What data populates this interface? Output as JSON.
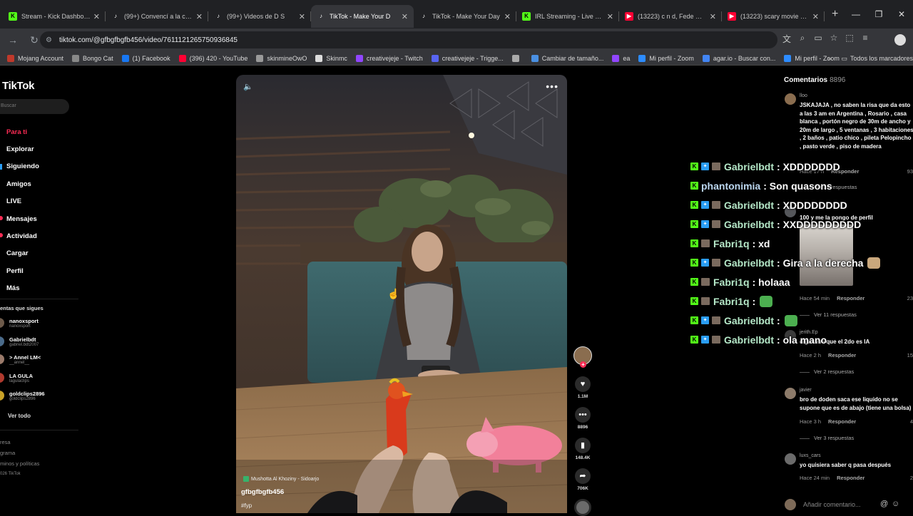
{
  "browser": {
    "tabs": [
      {
        "title": "Stream - Kick Dashboard",
        "icon": "kick-icon",
        "color": "#53fc18",
        "active": false
      },
      {
        "title": "(99+) Convencí a la chica a",
        "icon": "tiktok-icon",
        "color": "#ffffff",
        "active": false
      },
      {
        "title": "(99+) Videos de D  S",
        "icon": "tiktok-icon",
        "color": "#ffffff",
        "active": false
      },
      {
        "title": "TikTok - Make Your D",
        "icon": "tiktok-icon",
        "color": "#ffffff",
        "active": true
      },
      {
        "title": "TikTok - Make Your Day",
        "icon": "tiktok-icon",
        "color": "#ffffff",
        "active": false
      },
      {
        "title": "IRL Streaming - Live Strea",
        "icon": "kick-icon",
        "color": "#53fc18",
        "active": false
      },
      {
        "title": "(13223) c n d, Fede Guelm",
        "icon": "youtube-icon",
        "color": "#ff0033",
        "active": false
      },
      {
        "title": "(13223) scary movie 7 tra",
        "icon": "youtube-icon",
        "color": "#ff0033",
        "active": false
      }
    ],
    "new_tab": "+",
    "url": "tiktok.com/@gfbgfbgfb456/video/7611121265750936845",
    "bookmarks": [
      {
        "label": "Mojang Account",
        "color": "#c0392b"
      },
      {
        "label": "Bongo Cat",
        "color": "#888888"
      },
      {
        "label": "(1) Facebook",
        "color": "#1877f2"
      },
      {
        "label": "(396) 420 - YouTube",
        "color": "#ff0033"
      },
      {
        "label": "skinmineOwO",
        "color": "#999999"
      },
      {
        "label": "Skinmc",
        "color": "#dddddd"
      },
      {
        "label": "creativejeje - Twitch",
        "color": "#9146ff"
      },
      {
        "label": "creativejeje - Trigge...",
        "color": "#5865f2"
      },
      {
        "label": "",
        "color": "#aaaaaa"
      },
      {
        "label": "Cambiar de tamaño...",
        "color": "#4a90e2"
      },
      {
        "label": "ea",
        "color": "#9146ff"
      },
      {
        "label": "Mi perfil - Zoom",
        "color": "#2d8cff"
      },
      {
        "label": "agar.io - Buscar con...",
        "color": "#4285f4"
      },
      {
        "label": "Mi perfil - Zoom",
        "color": "#2d8cff"
      }
    ],
    "bookmarks_more": "»",
    "all_bookmarks": "Todos los marcadores"
  },
  "tiktok": {
    "logo": "TikTok",
    "search_placeholder": "Buscar",
    "nav": [
      {
        "label": "Para ti",
        "active": true
      },
      {
        "label": "Explorar",
        "active": false
      },
      {
        "label": "Siguiendo",
        "active": false
      },
      {
        "label": "Amigos",
        "active": false
      },
      {
        "label": "LIVE",
        "active": false
      },
      {
        "label": "Mensajes",
        "active": false,
        "dot": true
      },
      {
        "label": "Actividad",
        "active": false,
        "dot": true
      },
      {
        "label": "Cargar",
        "active": false
      },
      {
        "label": "Perfil",
        "active": false
      },
      {
        "label": "Más",
        "active": false
      }
    ],
    "following_header": "entas que sigues",
    "following": [
      {
        "name": "nanoxsport",
        "handle": "nanoxsport",
        "color": "#6d5a4a"
      },
      {
        "name": "Gabrielbdt",
        "handle": "gabriel.bdt2007",
        "color": "#4a6b8a"
      },
      {
        "name": "> Annel LM<",
        "handle": "__annel__",
        "color": "#9a7a6a"
      },
      {
        "name": "LA GULA",
        "handle": "lagulaclips",
        "color": "#b03a2e"
      },
      {
        "name": "goldclips2896",
        "handle": "goldclips2896",
        "color": "#c9a227"
      }
    ],
    "see_all": "Ver todo",
    "footer": [
      "resa",
      "grama",
      "minos y políticas",
      "026 TikTok"
    ]
  },
  "video": {
    "music": "Mushotta Al Khoziny - Sidoarjo",
    "author": "gfbgfbgfb456",
    "hashtag": "#fyp",
    "likes": "1.1M",
    "comments": "8896",
    "saves": "148.4K",
    "shares": "706K"
  },
  "comments": {
    "header": "Comentarios",
    "count": "8896",
    "items": [
      {
        "user": "lloo",
        "avatar": "#8a6d4f",
        "text": "JSKAJAJA , no saben la risa que da esto a las 3 am en Argentina , Rosario , casa blanca , portón negro de 30m de ancho y 20m de largo , 5 ventanas , 3 habitaciones , 2 baños , patio chico , pileta Pelopincho , pasto verde , piso de madera",
        "time": "Hace 17 h",
        "reply": "Responder",
        "likes": "93",
        "replies": "Ver 28 respuestas"
      },
      {
        "user": "",
        "avatar": "#55575b",
        "text": "100 y me la pongo de perfil",
        "time": "Hace 54 min",
        "reply": "Responder",
        "likes": "23",
        "replies": "Ver 11 respuestas"
      },
      {
        "user": "jerith.Ep",
        "avatar": "#3b3b3b",
        "text": "digamme que el 2do es IA",
        "time": "Hace 2 h",
        "reply": "Responder",
        "likes": "15",
        "replies": "Ver 2 respuestas"
      },
      {
        "user": "javier",
        "avatar": "#8d7b6a",
        "text": "bro de doden saca ese liquido no se supone que es de abajo (tiene una bolsa)",
        "time": "Hace 3 h",
        "reply": "Responder",
        "likes": "4",
        "replies": "Ver 3 respuestas"
      },
      {
        "user": "luxs_cars",
        "avatar": "#6b6b6b",
        "text": "yo quisiera saber q pasa después",
        "time": "Hace 24 min",
        "reply": "Responder",
        "likes": "2",
        "replies": ""
      }
    ],
    "add_placeholder": "Añadir comentario..."
  },
  "stream_chat": [
    {
      "user": "Gabrielbdt",
      "color": "#b5e8c8",
      "msg": ": XDDDDDDD",
      "badges": [
        "kick",
        "blue",
        "face"
      ],
      "emote": ""
    },
    {
      "user": "phantonimia",
      "color": "#bcd7f0",
      "msg": ": Son quasons",
      "badges": [
        "kick"
      ],
      "emote": ""
    },
    {
      "user": "Gabrielbdt",
      "color": "#b5e8c8",
      "msg": ": XDDDDDDDD",
      "badges": [
        "kick",
        "blue",
        "face"
      ],
      "emote": ""
    },
    {
      "user": "Gabrielbdt",
      "color": "#b5e8c8",
      "msg": ": XXDDDDDDDDD",
      "badges": [
        "kick",
        "blue",
        "face"
      ],
      "emote": ""
    },
    {
      "user": "Fabri1q",
      "color": "#b5e8c8",
      "msg": ": xd",
      "badges": [
        "kick",
        "face"
      ],
      "emote": ""
    },
    {
      "user": "Gabrielbdt",
      "color": "#b5e8c8",
      "msg": ": Gira a la derecha",
      "badges": [
        "kick",
        "blue",
        "face"
      ],
      "emote": "#c9a77c"
    },
    {
      "user": "Fabri1q",
      "color": "#b5e8c8",
      "msg": ": holaaa",
      "badges": [
        "kick",
        "face"
      ],
      "emote": ""
    },
    {
      "user": "Fabri1q",
      "color": "#b5e8c8",
      "msg": ":",
      "badges": [
        "kick",
        "face"
      ],
      "emote": "#4caf50"
    },
    {
      "user": "Gabrielbdt",
      "color": "#b5e8c8",
      "msg": ":",
      "badges": [
        "kick",
        "blue",
        "face"
      ],
      "emote": "#4caf50"
    },
    {
      "user": "Gabrielbdt",
      "color": "#b5e8c8",
      "msg": ": ola mano",
      "badges": [
        "kick",
        "blue",
        "face"
      ],
      "emote": ""
    }
  ]
}
